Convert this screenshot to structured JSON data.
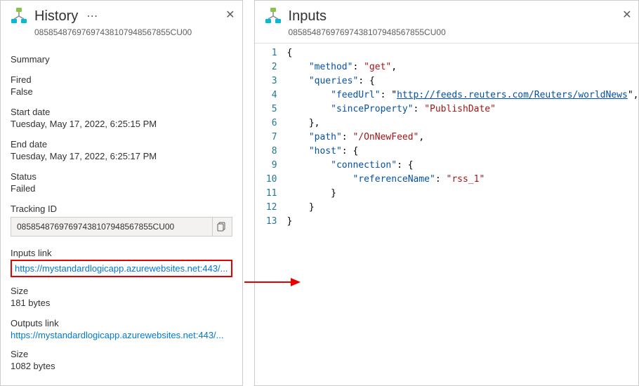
{
  "history": {
    "title": "History",
    "subtitle": "08585487697697438107948567855CU00",
    "summary_label": "Summary",
    "fired_label": "Fired",
    "fired_value": "False",
    "start_label": "Start date",
    "start_value": "Tuesday, May 17, 2022, 6:25:15 PM",
    "end_label": "End date",
    "end_value": "Tuesday, May 17, 2022, 6:25:17 PM",
    "status_label": "Status",
    "status_value": "Failed",
    "tracking_label": "Tracking ID",
    "tracking_value": "08585487697697438107948567855CU00",
    "inputs_link_label": "Inputs link",
    "inputs_link_value": "https://mystandardlogicapp.azurewebsites.net:443/...",
    "inputs_size_label": "Size",
    "inputs_size_value": "181 bytes",
    "outputs_link_label": "Outputs link",
    "outputs_link_value": "https://mystandardlogicapp.azurewebsites.net:443/...",
    "outputs_size_label": "Size",
    "outputs_size_value": "1082 bytes"
  },
  "inputs": {
    "title": "Inputs",
    "subtitle": "08585487697697438107948567855CU00",
    "line_count": 13,
    "json_data": {
      "method": "get",
      "queries": {
        "feedUrl": "http://feeds.reuters.com/Reuters/worldNews",
        "sinceProperty": "PublishDate"
      },
      "path": "/OnNewFeed",
      "host": {
        "connection": {
          "referenceName": "rss_1"
        }
      }
    }
  }
}
